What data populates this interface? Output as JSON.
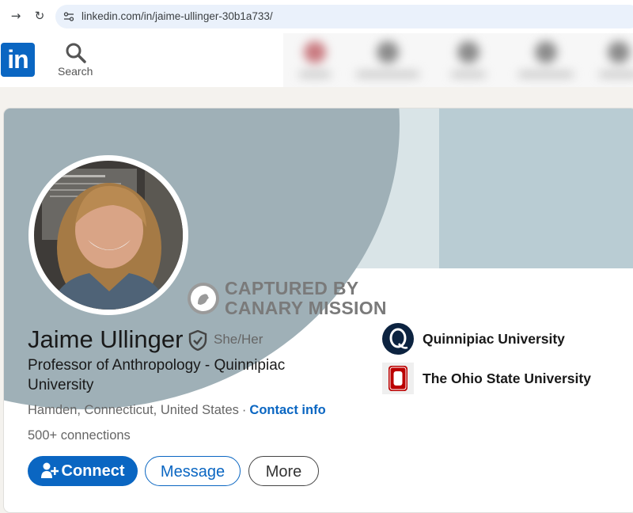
{
  "browser": {
    "back_icon": "arrow-right-icon",
    "reload_icon": "reload-icon",
    "url": "linkedin.com/in/jaime-ullinger-30b1a733/"
  },
  "header": {
    "logo_text": "in",
    "search_label": "Search",
    "brand_color": "#0a66c2"
  },
  "watermark": {
    "line1": "CAPTURED BY",
    "line2": "CANARY MISSION"
  },
  "profile": {
    "name": "Jaime Ullinger",
    "pronouns": "She/Her",
    "headline": "Professor of Anthropology - Quinnipiac University",
    "location": "Hamden, Connecticut, United States",
    "separator": "·",
    "contact_label": "Contact info",
    "connections": "500+ connections"
  },
  "actions": {
    "connect": "Connect",
    "message": "Message",
    "more": "More"
  },
  "education": [
    {
      "name": "Quinnipiac University",
      "logo_color": "#0c2340"
    },
    {
      "name": "The Ohio State University",
      "logo_color": "#bb0000"
    }
  ]
}
